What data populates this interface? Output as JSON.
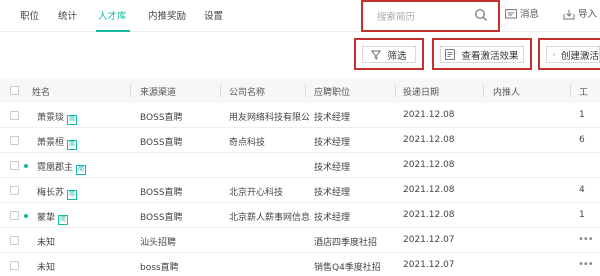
{
  "nav": {
    "tabs": [
      {
        "label": "职位"
      },
      {
        "label": "统计"
      },
      {
        "label": "人才库"
      },
      {
        "label": "内推奖励"
      },
      {
        "label": "设置"
      }
    ],
    "active_tab": "人才库",
    "search": {
      "placeholder": "搜索简历"
    },
    "messages_label": "消息",
    "import_label": "导入"
  },
  "actions": {
    "filter_label": "筛选",
    "activation_label": "查看激活效果",
    "create_label": "创建激活"
  },
  "table": {
    "columns": [
      "姓名",
      "来源渠道",
      "公司名称",
      "应聘职位",
      "投递日期",
      "内推人",
      "工"
    ],
    "rows": [
      {
        "name": "萧景琰",
        "badge": "简",
        "dot": false,
        "source": "BOSS直聘",
        "company": "用友网络科技有限公司",
        "position": "技术经理",
        "date": "2021.12.08",
        "referrer": "",
        "extra": "1"
      },
      {
        "name": "萧景桓",
        "badge": "简",
        "dot": false,
        "source": "BOSS直聘",
        "company": "奇点科技",
        "position": "技术经理",
        "date": "2021.12.08",
        "referrer": "",
        "extra": "6"
      },
      {
        "name": "霓凰郡主",
        "badge": "简",
        "dot": true,
        "source": "",
        "company": "",
        "position": "技术经理",
        "date": "2021.12.08",
        "referrer": "",
        "extra": ""
      },
      {
        "name": "梅长苏",
        "badge": "简",
        "dot": false,
        "source": "BOSS直聘",
        "company": "北京开心科技",
        "position": "技术经理",
        "date": "2021.12.08",
        "referrer": "",
        "extra": "4"
      },
      {
        "name": "蒙挚",
        "badge": "简",
        "dot": true,
        "source": "BOSS直聘",
        "company": "北京薪人薪事网信息...",
        "position": "技术经理",
        "date": "2021.12.08",
        "referrer": "",
        "extra": "1"
      },
      {
        "name": "未知",
        "badge": "",
        "dot": false,
        "source": "汕头招聘",
        "company": "",
        "position": "酒店四季度社招",
        "date": "2021.12.07",
        "referrer": "",
        "extra": ""
      },
      {
        "name": "未知",
        "badge": "",
        "dot": false,
        "source": "boss直聘",
        "company": "",
        "position": "销售Q4季度社招",
        "date": "2021.12.07",
        "referrer": "",
        "extra": ""
      }
    ]
  },
  "colors": {
    "accent": "#14b8a6",
    "highlight_border": "#c53030"
  },
  "icons": {
    "search": "search-icon",
    "messages": "message-icon",
    "import": "import-icon",
    "filter": "filter-icon",
    "activation": "report-icon",
    "create": "create-icon",
    "more": "more-icon"
  }
}
